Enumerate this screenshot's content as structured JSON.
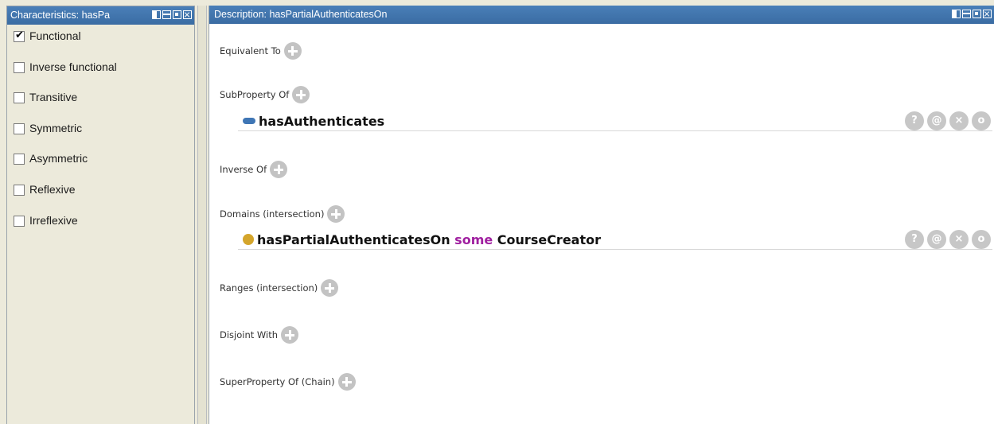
{
  "left_panel": {
    "title": "Characteristics: hasPa",
    "characteristics": [
      {
        "label": "Functional",
        "checked": true
      },
      {
        "label": "Inverse functional",
        "checked": false
      },
      {
        "label": "Transitive",
        "checked": false
      },
      {
        "label": "Symmetric",
        "checked": false
      },
      {
        "label": "Asymmetric",
        "checked": false
      },
      {
        "label": "Reflexive",
        "checked": false
      },
      {
        "label": "Irreflexive",
        "checked": false
      }
    ]
  },
  "right_panel": {
    "title": "Description: hasPartialAuthenticatesOn",
    "sections": {
      "equivalent_to": "Equivalent To",
      "subproperty_of": "SubProperty Of",
      "inverse_of": "Inverse Of",
      "domains": "Domains (intersection)",
      "ranges": "Ranges (intersection)",
      "disjoint_with": "Disjoint With",
      "superproperty_chain": "SuperProperty Of (Chain)"
    },
    "subproperty_entry": {
      "name": "hasAuthenticates"
    },
    "domain_entry": {
      "property": "hasPartialAuthenticatesOn",
      "keyword": "some",
      "class": "CourseCreator"
    },
    "entry_buttons": {
      "explain": "?",
      "annotate": "@",
      "delete": "×",
      "edit": "o"
    }
  },
  "colors": {
    "titlebar": "#3f74ad",
    "keyword": "#a020a0",
    "property_icon": "#3f76b5",
    "class_icon": "#d4a52b"
  }
}
